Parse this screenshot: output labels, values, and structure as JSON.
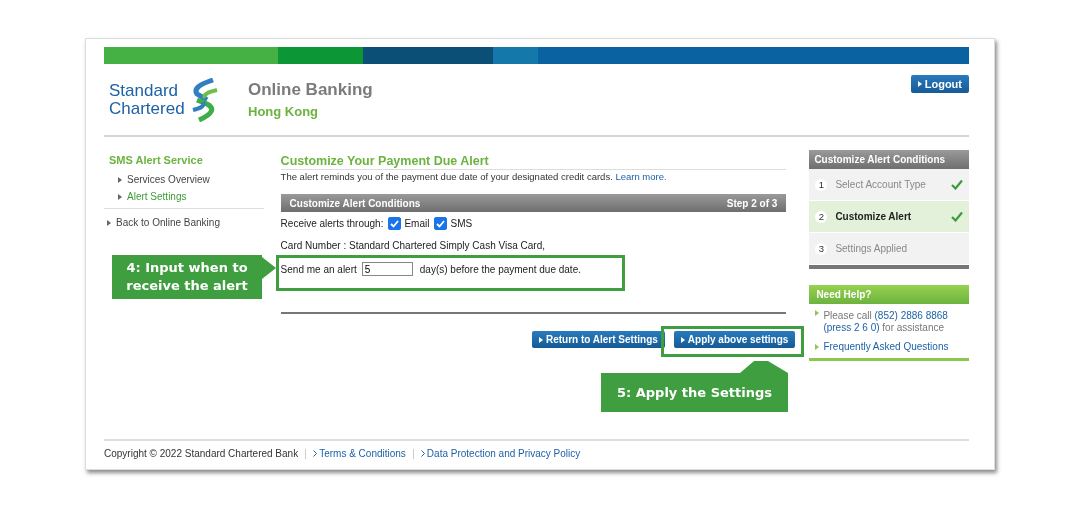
{
  "header": {
    "brand": [
      "Standard",
      "Chartered"
    ],
    "title": "Online Banking",
    "region": "Hong Kong",
    "logout": "Logout"
  },
  "sidebar": {
    "heading": "SMS Alert Service",
    "items": [
      {
        "label": "Services Overview",
        "selected": false
      },
      {
        "label": "Alert Settings",
        "selected": true
      }
    ],
    "back_link": "Back to Online Banking"
  },
  "main": {
    "title": "Customize Your Payment Due Alert",
    "description": "The alert reminds you of the payment due date of your designated credit cards.",
    "learn_more": "Learn more.",
    "panel_title": "Customize Alert Conditions",
    "step": "Step 2 of 3",
    "channels_label": "Receive alerts through:",
    "channels": [
      {
        "label": "Email",
        "checked": true
      },
      {
        "label": "SMS",
        "checked": true
      }
    ],
    "card_number": "Card Number : Standard Chartered Simply Cash Visa Card,",
    "alert_prefix": "Send me an alert",
    "days_value": "5",
    "alert_suffix": "day(s) before the payment due date.",
    "buttons": [
      "Return to Alert Settings",
      "Apply above settings"
    ]
  },
  "steps": {
    "title": "Customize Alert Conditions",
    "items": [
      {
        "number": "1",
        "label": "Select Account Type",
        "selected": false,
        "done": true
      },
      {
        "number": "2",
        "label": "Customize Alert",
        "selected": true,
        "done": true
      },
      {
        "number": "3",
        "label": "Settings Applied",
        "selected": false,
        "done": false
      }
    ]
  },
  "help": {
    "title": "Need Help?",
    "text_before": "Please call",
    "phone": "(852) 2886 8868",
    "press": "(press 2 6 0)",
    "text_after": "for assistance",
    "faq": "Frequently Asked Questions"
  },
  "footer": {
    "copyright": "Copyright © 2022 Standard Chartered Bank",
    "links": [
      "Terms & Conditions",
      "Data Protection and Privacy Policy"
    ]
  },
  "annotations": [
    {
      "text": "4: Input when to receive the alert",
      "kind": "side"
    },
    {
      "text": "5: Apply the Settings",
      "kind": "below"
    }
  ]
}
